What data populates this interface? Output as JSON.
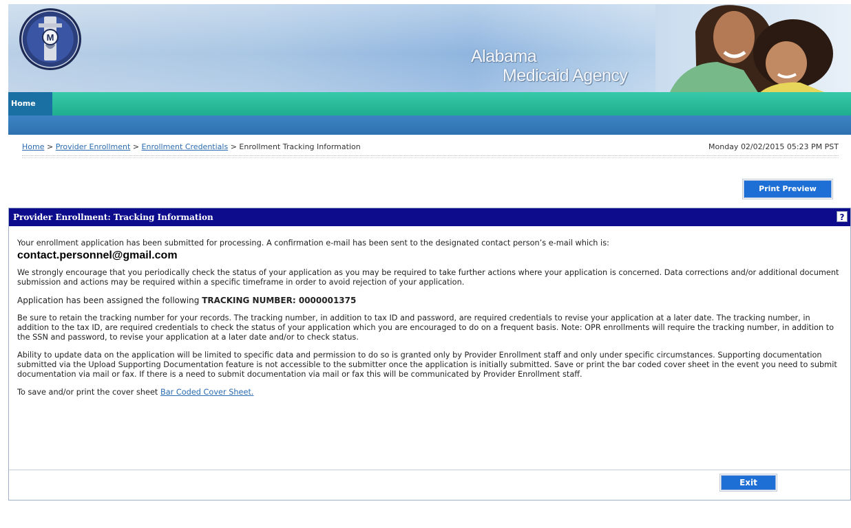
{
  "banner": {
    "agency_line1": "Alabama",
    "agency_line2": "Medicaid Agency",
    "seal_letter": "M"
  },
  "nav": {
    "home_label": "Home"
  },
  "breadcrumb": {
    "items": [
      "Home",
      "Provider Enrollment",
      "Enrollment Credentials"
    ],
    "separator": ">",
    "current": "Enrollment Tracking Information"
  },
  "datetime": "Monday 02/02/2015 05:23 PM PST",
  "toolbar": {
    "print_preview_label": "Print Preview"
  },
  "panel": {
    "title": "Provider Enrollment: Tracking Information",
    "help_label": "?",
    "intro": "Your enrollment application has been submitted for processing. A confirmation e-mail has been sent to the designated contact person’s e-mail which is:",
    "email": "contact.personnel@gmail.com",
    "encourage": "We strongly encourage that you periodically check the status of your application as you may be required to take further actions where your application is concerned. Data corrections and/or additional document submission and actions may be required within a specific timeframe in order to avoid rejection of your application.",
    "tracking_prefix": "Application has been assigned the following",
    "tracking_label": "TRACKING NUMBER: 0000001375",
    "retain": "Be sure to retain the tracking number for your records. The tracking number, in addition to tax ID and password, are required credentials to revise your application at a later date. The tracking number, in addition to the tax ID, are required credentials to check the status of your application which you are encouraged to do on a frequent basis. Note: OPR enrollments will require the tracking number, in addition to the SSN and password, to revise your application at a later date and/or to check status.",
    "ability": "Ability to update data on the application will be limited to specific data and permission to do so is granted only by Provider Enrollment staff and only under specific circumstances. Supporting documentation submitted via the Upload Supporting Documentation feature is not accessible to the submitter once the application is initially submitted. Save or print the bar coded cover sheet in the event you need to submit documentation via mail or fax. If there is a need to submit documentation via mail or fax this will be communicated by Provider Enrollment staff.",
    "save_prefix": "To save and/or print the cover sheet",
    "cover_sheet_link": "Bar Coded Cover Sheet.",
    "exit_label": "Exit"
  },
  "colors": {
    "nav_green": "#1fae8f",
    "nav_blue": "#2f72b0",
    "panel_header": "#0c0c8c",
    "button_blue": "#1d6fd6",
    "link_blue": "#2a6bb1"
  }
}
